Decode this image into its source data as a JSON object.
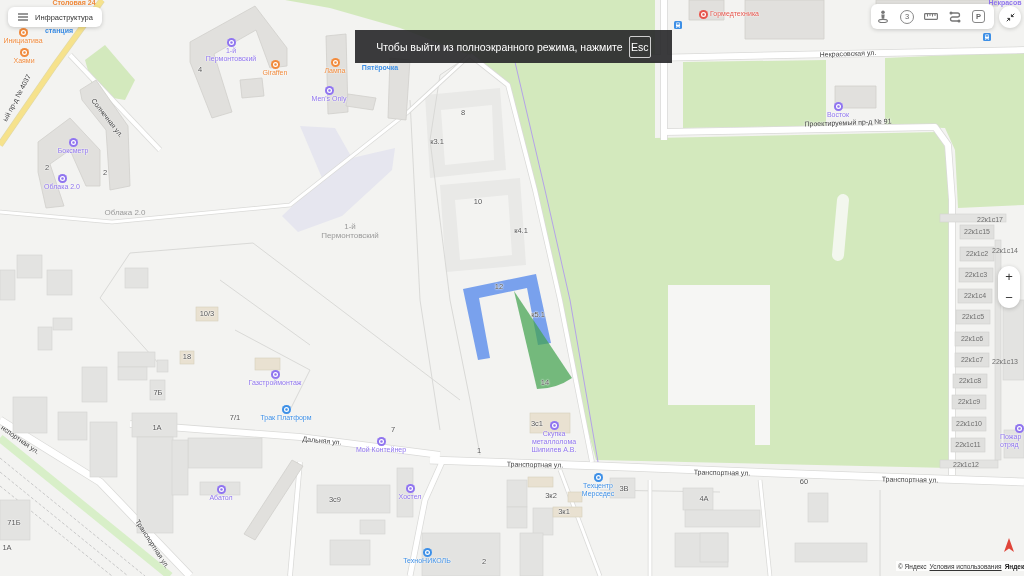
{
  "infrastructure_button": {
    "label": "Инфраструктура"
  },
  "fullscreen_notice": {
    "text": "Чтобы выйти из полноэкранного режима, нажмите",
    "key": "Esc"
  },
  "toolbar": [
    {
      "kind": "person"
    },
    {
      "kind": "circled",
      "text": "3"
    },
    {
      "kind": "ruler"
    },
    {
      "kind": "route"
    },
    {
      "kind": "boxed",
      "text": "P"
    }
  ],
  "zoom": {
    "zoom_in": "+",
    "zoom_out": "−"
  },
  "pois": [
    {
      "name": "Столовая 24",
      "color": "#f08a3c"
    },
    {
      "name": "станция",
      "color": "#3d8fe6"
    },
    {
      "name": "Инициатива",
      "color": "#f08a3c"
    },
    {
      "name": "Хаями",
      "color": "#f08a3c"
    },
    {
      "name": "1-й Пермонтовский",
      "color": "#8f74ee"
    },
    {
      "name": "Giraffen",
      "color": "#f08a3c"
    },
    {
      "name": "Лампа",
      "color": "#f08a3c"
    },
    {
      "name": "Пятёрочка",
      "color": "#3d8fe6"
    },
    {
      "name": "Men's Only",
      "color": "#8f74ee"
    },
    {
      "name": "Боксметр",
      "color": "#8f74ee"
    },
    {
      "name": "Облака 2.0",
      "color": "#8f74ee"
    },
    {
      "name": "Гормедтехника",
      "color": "#e5544b"
    },
    {
      "name": "Восток",
      "color": "#8f74ee"
    },
    {
      "name": "Некрасов",
      "color": "#8f74ee"
    },
    {
      "name": "Газстроймонтаж",
      "color": "#8f74ee"
    },
    {
      "name": "Трак Платформ",
      "color": "#3d8fe6"
    },
    {
      "name": "Мой Контейнер",
      "color": "#8f74ee"
    },
    {
      "name": "Абатол",
      "color": "#8f74ee"
    },
    {
      "name": "Хостел",
      "color": "#8f74ee"
    },
    {
      "name": "Скупка металлолома Шипилев А.В.",
      "color": "#8f74ee"
    },
    {
      "name": "Техцентр Мерседес",
      "color": "#3d8fe6"
    },
    {
      "name": "ТехноНИКОЛЬ",
      "color": "#3d8fe6"
    },
    {
      "name": "Пожар отряд",
      "color": "#8f74ee"
    }
  ],
  "district_labels": [
    "Облака 2.0",
    "1-й Пермонтовский"
  ],
  "street_labels": [
    "ый пр-д № 4037",
    "Солнечная ул.",
    "Некрасовская ул.",
    "Проектируемый пр-д № 91",
    "Дальняя ул.",
    "Транспортная ул.",
    "Транспортная ул.",
    "Транспортная ул.",
    "нспортная ул.",
    "Транспортная ул."
  ],
  "building_numbers": [
    "4",
    "2",
    "2",
    "8",
    "к3.1",
    "10",
    "к4.1",
    "12",
    "к5.1",
    "14",
    "3с1",
    "1",
    "3В",
    "3к2",
    "3к1",
    "4А",
    "2",
    "60",
    "10/3",
    "18",
    "7Б",
    "7/1",
    "1А",
    "7",
    "3с9",
    "71Б",
    "1А"
  ],
  "garage_numbers": [
    "22к1с17",
    "22к1с15",
    "22к1с2",
    "22к1с14",
    "22к1с3",
    "22к1с4",
    "22к1с5",
    "22к1с6",
    "22к1с7",
    "22к1с13",
    "22к1с8",
    "22к1с9",
    "22к1с10",
    "22к1с11",
    "22к1с12"
  ],
  "attribution": {
    "copyright": "© Яндекс",
    "terms_link": "Условия использования",
    "logo": "Яндек"
  }
}
